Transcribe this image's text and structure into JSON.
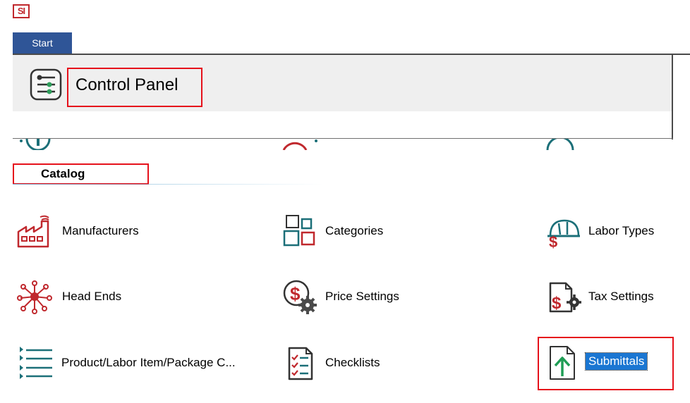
{
  "app": {
    "logo_text": "SI"
  },
  "tabs": {
    "start_label": "Start"
  },
  "control_panel": {
    "title": "Control Panel"
  },
  "section": {
    "title": "Catalog"
  },
  "items": [
    {
      "label": "Manufacturers",
      "icon": "factory-icon"
    },
    {
      "label": "Categories",
      "icon": "categories-icon"
    },
    {
      "label": "Labor Types",
      "icon": "hardhat-dollar-icon"
    },
    {
      "label": "Head Ends",
      "icon": "network-hub-icon"
    },
    {
      "label": "Price Settings",
      "icon": "dollar-gear-icon"
    },
    {
      "label": "Tax Settings",
      "icon": "tax-document-icon"
    },
    {
      "label": "Product/Labor  Item/Package  C...",
      "icon": "list-icon"
    },
    {
      "label": "Checklists",
      "icon": "checklist-icon"
    },
    {
      "label": "Submittals",
      "icon": "submittal-upload-icon",
      "selected": true
    }
  ],
  "colors": {
    "accent": "#2f5597",
    "brand_red": "#c0282d",
    "teal": "#1b6f78",
    "highlight": "#e6111b",
    "selection": "#1a76d2"
  }
}
